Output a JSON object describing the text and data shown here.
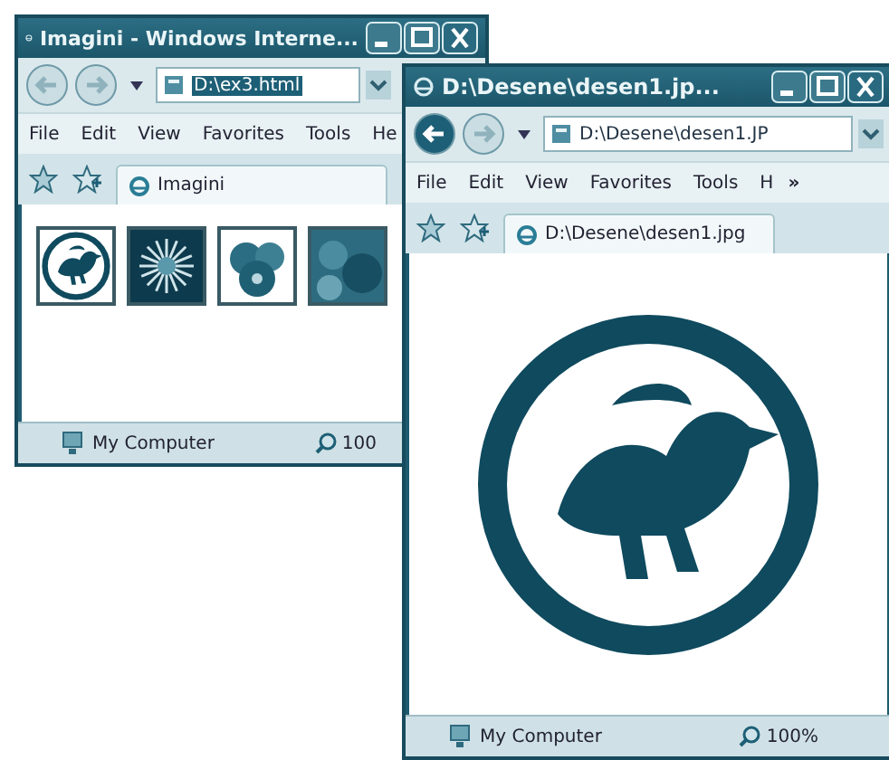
{
  "windows": [
    {
      "title": "Imagini - Windows Interne...",
      "address": "D:\\ex3.html",
      "address_selected": true,
      "menu": [
        "File",
        "Edit",
        "View",
        "Favorites",
        "Tools",
        "He"
      ],
      "tab": "Imagini",
      "content": {
        "kind": "thumbnails",
        "items": [
          {
            "kind": "emblem"
          },
          {
            "kind": "flower"
          },
          {
            "kind": "fruit"
          },
          {
            "kind": "photo"
          }
        ]
      },
      "status": "My Computer",
      "zoom": "100"
    },
    {
      "title": "D:\\Desene\\desen1.jp...",
      "address": "D:\\Desene\\desen1.JP",
      "address_selected": false,
      "menu": [
        "File",
        "Edit",
        "View",
        "Favorites",
        "Tools",
        "H"
      ],
      "menu_overflow": "»",
      "tab": "D:\\Desene\\desen1.jpg",
      "content": {
        "kind": "image"
      },
      "status": "My Computer",
      "zoom": "100%"
    }
  ]
}
